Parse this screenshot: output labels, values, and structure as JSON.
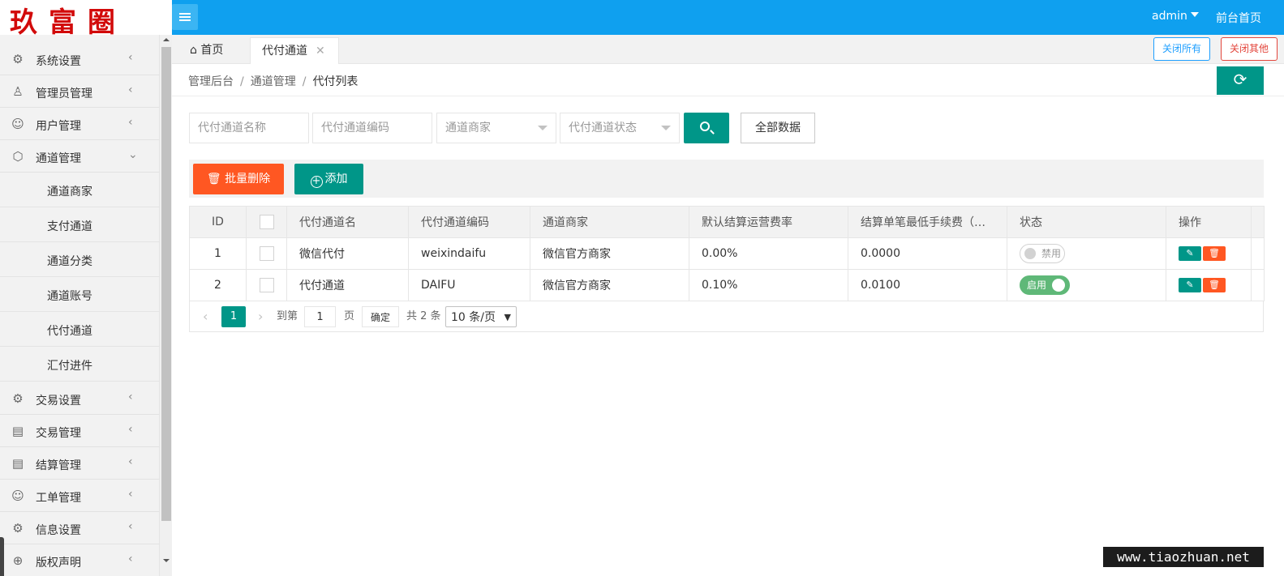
{
  "logo": {
    "text": "玖富圈"
  },
  "header": {
    "user": "admin",
    "front_link": "前台首页"
  },
  "sidebar": {
    "items": [
      {
        "label": "系统设置",
        "icon": "gear-icon",
        "glyph": "⚙",
        "arrow": "‹"
      },
      {
        "label": "管理员管理",
        "icon": "user-icon",
        "glyph": "♙",
        "arrow": "‹"
      },
      {
        "label": "用户管理",
        "icon": "users-icon",
        "glyph": "☺",
        "arrow": "‹"
      },
      {
        "label": "通道管理",
        "icon": "cube-icon",
        "glyph": "⬡",
        "arrow": "⌄"
      },
      {
        "label": "交易设置",
        "icon": "gear-icon",
        "glyph": "⚙",
        "arrow": "‹"
      },
      {
        "label": "交易管理",
        "icon": "clipboard-icon",
        "glyph": "▤",
        "arrow": "‹"
      },
      {
        "label": "结算管理",
        "icon": "clipboard-icon",
        "glyph": "▤",
        "arrow": "‹"
      },
      {
        "label": "工单管理",
        "icon": "smile-icon",
        "glyph": "☺",
        "arrow": "‹"
      },
      {
        "label": "信息设置",
        "icon": "gear-icon",
        "glyph": "⚙",
        "arrow": "‹"
      },
      {
        "label": "版权声明",
        "icon": "plus-circle-icon",
        "glyph": "⊕",
        "arrow": "‹"
      }
    ],
    "sub_items": [
      "通道商家",
      "支付通道",
      "通道分类",
      "通道账号",
      "代付通道",
      "汇付进件"
    ]
  },
  "tabs": {
    "home": "首页",
    "active": "代付通道",
    "close_all": "关闭所有",
    "close_other": "关闭其他"
  },
  "breadcrumb": {
    "items": [
      "管理后台",
      "通道管理",
      "代付列表"
    ],
    "separator": "/"
  },
  "filters": {
    "name_placeholder": "代付通道名称",
    "code_placeholder": "代付通道编码",
    "merchant_select": "通道商家",
    "status_select": "代付通道状态",
    "all_data": "全部数据"
  },
  "toolbar": {
    "batch_delete": "批量删除",
    "add": "添加"
  },
  "table": {
    "headers": [
      "ID",
      "代付通道名",
      "代付通道编码",
      "通道商家",
      "默认结算运营费率",
      "结算单笔最低手续费（元）",
      "状态",
      "操作"
    ],
    "rows": [
      {
        "id": "1",
        "name": "微信代付",
        "code": "weixindaifu",
        "merchant": "微信官方商家",
        "rate": "0.00%",
        "min_fee": "0.0000",
        "status": "禁用"
      },
      {
        "id": "2",
        "name": "代付通道",
        "code": "DAIFU",
        "merchant": "微信官方商家",
        "rate": "0.10%",
        "min_fee": "0.0100",
        "status": "启用"
      }
    ]
  },
  "pagination": {
    "current": "1",
    "goto": "到第",
    "input": "1",
    "unit": "页",
    "ok": "确定",
    "total": "共 2 条",
    "size": "10 条/页"
  },
  "watermark": "www.tiaozhuan.net",
  "colors": {
    "header": "#0fa0ef",
    "primary": "#009688",
    "danger": "#ff5722",
    "switch_on": "#5fb878",
    "close_all": "#1e9fff",
    "close_other": "#e3463c"
  }
}
